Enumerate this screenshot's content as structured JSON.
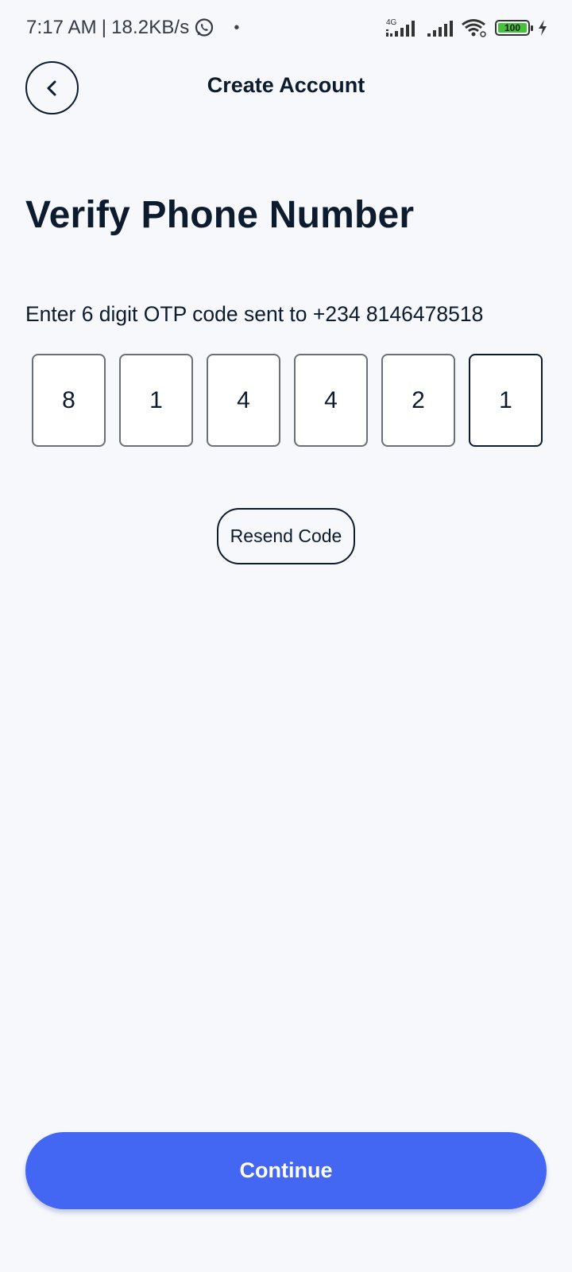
{
  "status_bar": {
    "time": "7:17 AM",
    "separator": "|",
    "speed": "18.2KB/s",
    "dot": "•",
    "network_type": "4G",
    "battery": "100",
    "icons": [
      "whatsapp-icon",
      "signal-4g-icon",
      "signal-icon",
      "wifi-icon",
      "battery-icon",
      "charging-icon"
    ]
  },
  "header": {
    "title": "Create Account",
    "back_icon": "chevron-left-icon"
  },
  "main": {
    "title": "Verify Phone Number",
    "instruction": "Enter 6 digit OTP code sent to +234 8146478518",
    "otp_digits": [
      "8",
      "1",
      "4",
      "4",
      "2",
      "1"
    ],
    "resend_label": "Resend Code"
  },
  "footer": {
    "continue_label": "Continue"
  },
  "colors": {
    "background": "#f6f8fc",
    "text": "#0d1b2e",
    "accent": "#4367f2",
    "battery": "#44c23a"
  }
}
